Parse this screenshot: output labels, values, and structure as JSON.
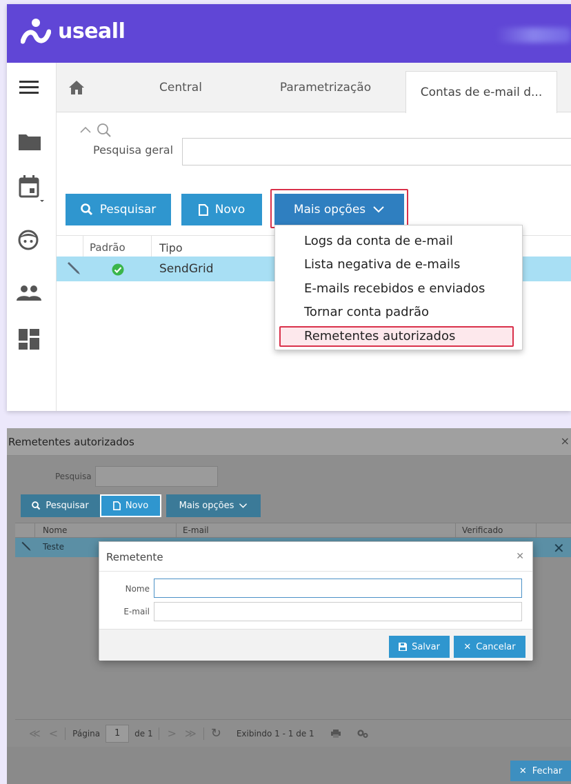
{
  "app": {
    "brand": "useall"
  },
  "tabs": [
    {
      "label": "Central"
    },
    {
      "label": "Parametrização"
    },
    {
      "label": "Contas de e-mail d..."
    }
  ],
  "search": {
    "label": "Pesquisa geral",
    "value": ""
  },
  "toolbar": {
    "pesquisar_label": "Pesquisar",
    "novo_label": "Novo",
    "mais_opcoes_label": "Mais opções"
  },
  "grid": {
    "columns": [
      "Padrão",
      "Tipo"
    ],
    "rows": [
      {
        "padrao": "check",
        "tipo": "SendGrid"
      }
    ]
  },
  "dropdown": {
    "items": [
      "Logs da conta de e-mail",
      "Lista negativa de e-mails",
      "E-mails recebidos e enviados",
      "Tornar conta padrão",
      "Remetentes autorizados"
    ],
    "highlighted_index": 4
  },
  "sub_window": {
    "title": "Remetentes autorizados",
    "search_label": "Pesquisa",
    "buttons": {
      "pesquisar": "Pesquisar",
      "novo": "Novo",
      "mais_opcoes": "Mais opções"
    },
    "columns": [
      "Nome",
      "E-mail",
      "Verificado"
    ],
    "rows": [
      {
        "nome": "Teste",
        "email": "",
        "verificado": ""
      }
    ],
    "pager": {
      "page_label": "Página",
      "page_value": "1",
      "of_label": "de 1",
      "display_text": "Exibindo 1 - 1 de 1"
    },
    "fechar_label": "Fechar"
  },
  "modal": {
    "title": "Remetente",
    "fields": [
      {
        "label": "Nome",
        "value": ""
      },
      {
        "label": "E-mail",
        "value": ""
      }
    ],
    "salvar_label": "Salvar",
    "cancelar_label": "Cancelar"
  },
  "colors": {
    "header": "#6046d6",
    "primary_button": "#2f96cf",
    "selected_row": "#a8dff4",
    "highlight_border": "#d9304a",
    "check_green": "#3ab54a"
  }
}
